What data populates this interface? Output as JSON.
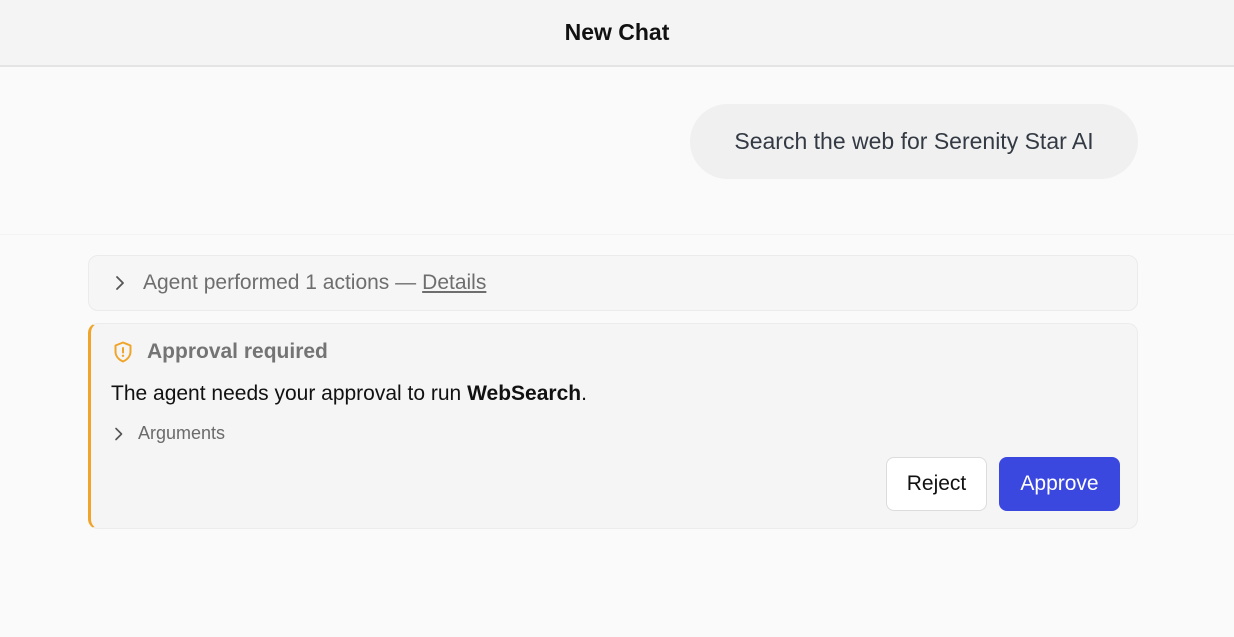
{
  "header": {
    "title": "New Chat"
  },
  "conversation": {
    "user_message": "Search the web for Serenity Star AI",
    "actions_summary": {
      "text": "Agent performed 1 actions —",
      "details_label": "Details"
    },
    "approval": {
      "title": "Approval required",
      "message_prefix": "The agent needs your approval to run ",
      "tool_name": "WebSearch",
      "message_suffix": ".",
      "arguments_label": "Arguments",
      "reject_label": "Reject",
      "approve_label": "Approve"
    }
  },
  "colors": {
    "accent": "#3b48e0",
    "warning": "#f0a52a"
  },
  "icons": {
    "expand": "chevron-right-icon",
    "approval": "shield-alert-icon"
  }
}
